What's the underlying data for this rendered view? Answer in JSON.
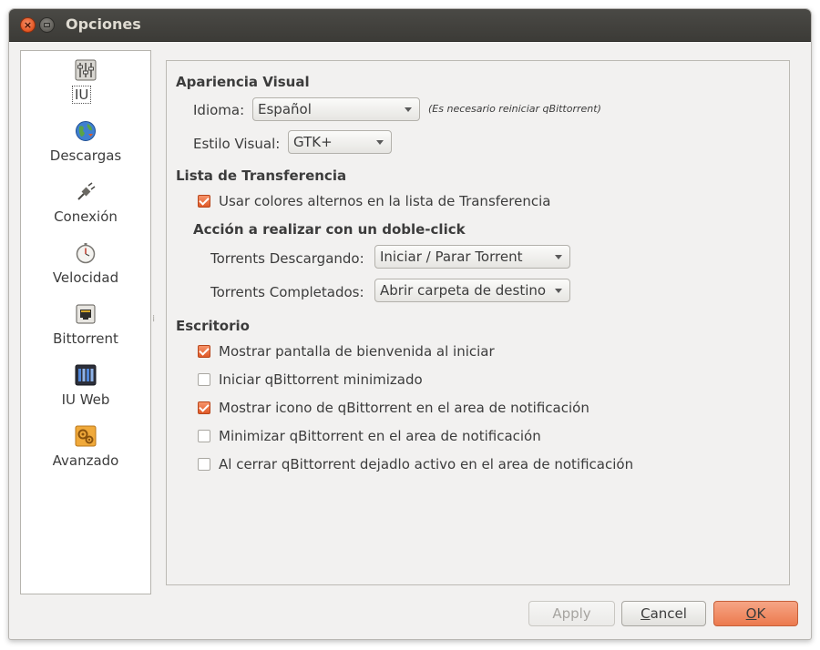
{
  "window": {
    "title": "Opciones",
    "close_glyph": "×"
  },
  "sidebar": {
    "items": [
      {
        "label": "IU",
        "icon": "sliders-icon",
        "selected": true
      },
      {
        "label": "Descargas",
        "icon": "globe-icon"
      },
      {
        "label": "Conexión",
        "icon": "plug-icon"
      },
      {
        "label": "Velocidad",
        "icon": "stopwatch-icon"
      },
      {
        "label": "Bittorrent",
        "icon": "network-port-icon"
      },
      {
        "label": "IU Web",
        "icon": "web-ui-icon"
      },
      {
        "label": "Avanzado",
        "icon": "gears-icon"
      }
    ]
  },
  "visual": {
    "heading": "Apariencia Visual",
    "language_label": "Idioma:",
    "language_value": "Español",
    "restart_note": "(Es necesario reiniciar qBittorrent)",
    "style_label": "Estilo Visual:",
    "style_value": "GTK+"
  },
  "transfer": {
    "heading": "Lista de Transferencia",
    "alt_colors_label": "Usar colores alternos en la lista de Transferencia",
    "alt_colors_checked": true,
    "dblclick_heading": "Acción a realizar con un doble-click",
    "downloading_label": "Torrents Descargando:",
    "downloading_value": "Iniciar / Parar Torrent",
    "completed_label": "Torrents Completados:",
    "completed_value": "Abrir carpeta de destino"
  },
  "desktop": {
    "heading": "Escritorio",
    "options": [
      {
        "label": "Mostrar pantalla de bienvenida al iniciar",
        "checked": true
      },
      {
        "label": "Iniciar qBittorrent minimizado",
        "checked": false
      },
      {
        "label": "Mostrar icono de qBittorrent en el area de notificación",
        "checked": true
      },
      {
        "label": "Minimizar qBittorrent en el area de notificación",
        "checked": false
      },
      {
        "label": "Al cerrar qBittorrent dejadlo activo en el area de notificación",
        "checked": false
      }
    ]
  },
  "buttons": {
    "apply": "Apply",
    "cancel_first": "C",
    "cancel_rest": "ancel",
    "ok_first": "O",
    "ok_rest": "K"
  },
  "colors": {
    "accent": "#ec7a4e",
    "titlebar": "#3c3b37",
    "window_bg": "#f2f1f0"
  }
}
